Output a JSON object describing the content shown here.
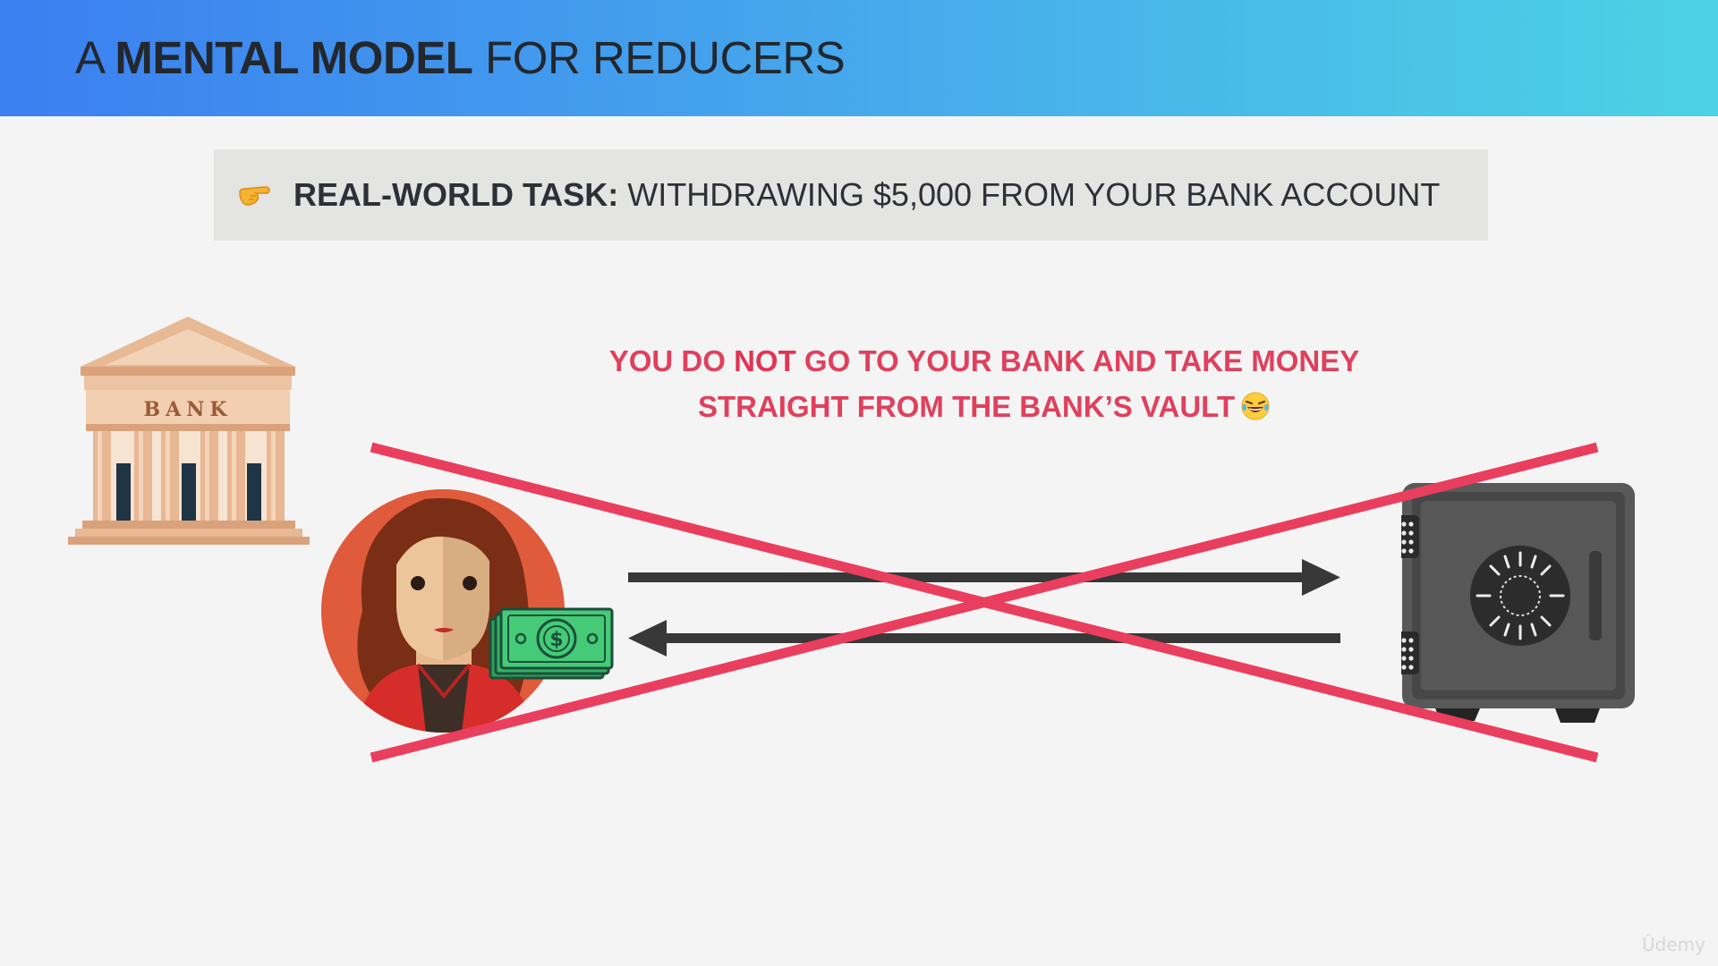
{
  "header": {
    "title_prefix": "A ",
    "title_bold": "MENTAL MODEL",
    "title_suffix": " FOR REDUCERS",
    "gradient": [
      "#3b7ff0",
      "#4cd2e4"
    ]
  },
  "task": {
    "icon": "pointing-hand-emoji",
    "label": "REAL-WORLD TASK:",
    "text": " WITHDRAWING $5,000 FROM YOUR BANK ACCOUNT"
  },
  "headline": {
    "line1_a": "YOU DO ",
    "line1_strong": "NOT",
    "line1_b": " GO TO YOUR BANK AND TAKE MONEY",
    "line2": "STRAIGHT FROM THE BANK’S VAULT",
    "emoji": "tears-of-joy-emoji",
    "color": "#e0405d"
  },
  "bank": {
    "sign": "BANK"
  },
  "illustration": {
    "person": "woman-avatar",
    "money": "cash-stack-icon",
    "vault": "safe-icon",
    "cross_color": "#ea3e5f",
    "arrow_color": "#383838"
  },
  "watermark": "Ûdemy"
}
